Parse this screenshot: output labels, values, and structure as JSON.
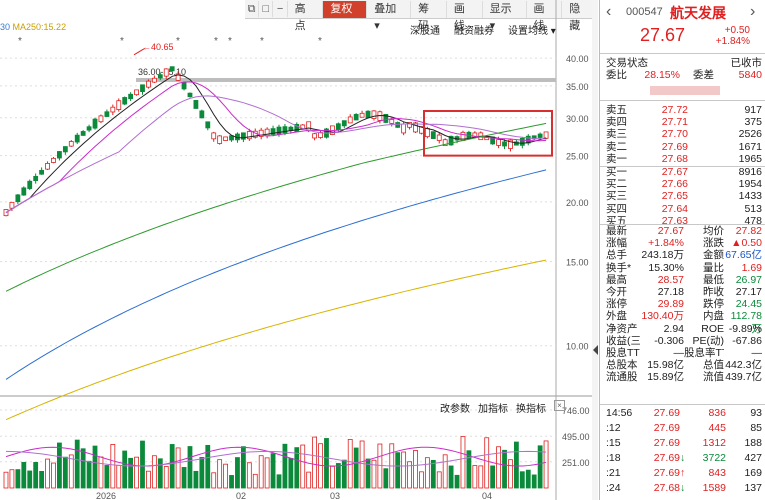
{
  "toolbar": {
    "buttons": [
      "高点",
      "复权",
      "叠加",
      "筹码",
      "画线",
      "显示",
      "画线",
      "隐藏"
    ],
    "active": "复权",
    "dropdown_marks": [
      "",
      "▾",
      "▾",
      "",
      "",
      "▾",
      "",
      ""
    ]
  },
  "ma_legend": {
    "prefix": "30",
    "text": "MA250:15.22"
  },
  "chart_tools": {
    "shenguyuan": "深股通",
    "rongzi": "融资融券",
    "settings": "设置均线 ▾"
  },
  "volume_tools": {
    "change_param": "改参数",
    "add_indicator": "加指标",
    "switch_indicator": "换指标"
  },
  "chart": {
    "price_axis": [
      "40.00",
      "35.00",
      "30.00",
      "25.00",
      "20.00",
      "15.00",
      "10.00"
    ],
    "high_label": "40.65",
    "range_label": "36.00-35.10",
    "volume_axis": [
      "746.00",
      "495.00",
      "251.00"
    ],
    "date_labels": [
      "2026",
      "02",
      "03",
      "04"
    ]
  },
  "chart_data": {
    "type": "candlestick",
    "ylim": [
      8,
      42
    ],
    "volume_ylim": [
      0,
      746
    ],
    "high": 40.65,
    "last": 27.67,
    "ma250": 15.22
  },
  "quote": {
    "code": "000547",
    "name": "航天发展",
    "price": "27.67",
    "change": "+0.50",
    "change_pct": "+1.84%",
    "status_label": "交易状态",
    "status_value": "已收市",
    "weibi_label": "委比",
    "weibi_value": "28.15%",
    "weicha_label": "委差",
    "weicha_value": "5840",
    "sells": [
      {
        "label": "卖五",
        "price": "27.72",
        "vol": "917"
      },
      {
        "label": "卖四",
        "price": "27.71",
        "vol": "375"
      },
      {
        "label": "卖三",
        "price": "27.70",
        "vol": "2526"
      },
      {
        "label": "卖二",
        "price": "27.69",
        "vol": "1671"
      },
      {
        "label": "卖一",
        "price": "27.68",
        "vol": "1965"
      }
    ],
    "buys": [
      {
        "label": "买一",
        "price": "27.67",
        "vol": "8916"
      },
      {
        "label": "买二",
        "price": "27.66",
        "vol": "1954"
      },
      {
        "label": "买三",
        "price": "27.65",
        "vol": "1433"
      },
      {
        "label": "买四",
        "price": "27.64",
        "vol": "513"
      },
      {
        "label": "买五",
        "price": "27.63",
        "vol": "478"
      }
    ],
    "stats": [
      {
        "l1": "最新",
        "v1": "27.67",
        "c1": "red",
        "l2": "均价",
        "v2": "27.82",
        "c2": "red"
      },
      {
        "l1": "涨幅",
        "v1": "+1.84%",
        "c1": "red",
        "l2": "涨跌",
        "v2": "▲0.50",
        "c2": "red"
      },
      {
        "l1": "总手",
        "v1": "243.18万",
        "c1": "",
        "l2": "金额",
        "v2": "67.65亿",
        "c2": "blue"
      },
      {
        "l1": "换手*",
        "v1": "15.30%",
        "c1": "",
        "l2": "量比",
        "v2": "1.69",
        "c2": "red"
      },
      {
        "l1": "最高",
        "v1": "28.57",
        "c1": "red",
        "l2": "最低",
        "v2": "26.97",
        "c2": "green"
      },
      {
        "l1": "今开",
        "v1": "27.18",
        "c1": "",
        "l2": "昨收",
        "v2": "27.17",
        "c2": ""
      },
      {
        "l1": "涨停",
        "v1": "29.89",
        "c1": "red",
        "l2": "跌停",
        "v2": "24.45",
        "c2": "green"
      },
      {
        "l1": "外盘",
        "v1": "130.40万",
        "c1": "red",
        "l2": "内盘",
        "v2": "112.78万",
        "c2": "green"
      },
      {
        "l1": "净资产",
        "v1": "2.94",
        "c1": "",
        "l2": "ROE",
        "v2": "-9.89%",
        "c2": ""
      },
      {
        "l1": "收益(三)",
        "v1": "-0.306",
        "c1": "",
        "l2": "PE(动)",
        "v2": "-67.86",
        "c2": ""
      },
      {
        "l1": "股息TTM",
        "v1": "—",
        "c1": "",
        "l2": "股息率TTM",
        "v2": "—",
        "c2": ""
      },
      {
        "l1": "总股本",
        "v1": "15.98亿",
        "c1": "",
        "l2": "总值",
        "v2": "442.3亿",
        "c2": ""
      },
      {
        "l1": "流通股",
        "v1": "15.89亿",
        "c1": "",
        "l2": "流值",
        "v2": "439.7亿",
        "c2": ""
      }
    ],
    "ticks": [
      {
        "time": "14:56",
        "price": "27.69",
        "vol": "836",
        "num": "93",
        "arrow": ""
      },
      {
        "time": ":12",
        "price": "27.69",
        "vol": "445",
        "num": "85",
        "arrow": ""
      },
      {
        "time": ":15",
        "price": "27.69",
        "vol": "1312",
        "num": "188",
        "arrow": ""
      },
      {
        "time": ":18",
        "price": "27.69",
        "vol": "3722",
        "num": "427",
        "arrow": "↓"
      },
      {
        "time": ":21",
        "price": "27.69",
        "vol": "843",
        "num": "169",
        "arrow": "↑"
      },
      {
        "time": ":24",
        "price": "27.68",
        "vol": "1589",
        "num": "137",
        "arrow": "↓"
      }
    ],
    "colors": {
      "up": "#e02020",
      "down": "#0a8a3a",
      "brand": "#e02020"
    }
  }
}
